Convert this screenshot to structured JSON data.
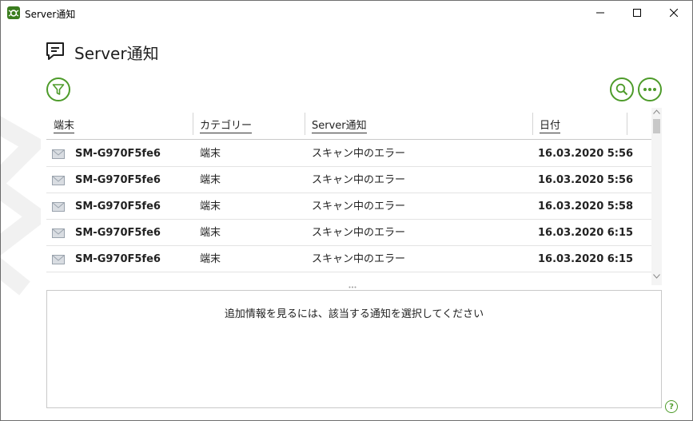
{
  "window": {
    "title": "Server通知",
    "accent": "#4d9b2a"
  },
  "page": {
    "title": "Server通知"
  },
  "table": {
    "columns": [
      "端末",
      "カテゴリー",
      "Server通知",
      "日付"
    ],
    "rows": [
      {
        "device": "SM-G970F5fe6",
        "category": "端末",
        "notice": "スキャン中のエラー",
        "date": "16.03.2020 5:56"
      },
      {
        "device": "SM-G970F5fe6",
        "category": "端末",
        "notice": "スキャン中のエラー",
        "date": "16.03.2020 5:56"
      },
      {
        "device": "SM-G970F5fe6",
        "category": "端末",
        "notice": "スキャン中のエラー",
        "date": "16.03.2020 5:58"
      },
      {
        "device": "SM-G970F5fe6",
        "category": "端末",
        "notice": "スキャン中のエラー",
        "date": "16.03.2020 6:15"
      },
      {
        "device": "SM-G970F5fe6",
        "category": "端末",
        "notice": "スキャン中のエラー",
        "date": "16.03.2020 6:15"
      }
    ]
  },
  "detail": {
    "message": "追加情報を見るには、該当する通知を選択してください"
  },
  "icons": {
    "app": "drweb-spider-icon",
    "header": "notification-chat-icon",
    "filter": "filter-icon",
    "search": "search-icon",
    "more": "more-options-icon",
    "row": "envelope-icon",
    "help": "help-icon"
  },
  "help_label": "?"
}
